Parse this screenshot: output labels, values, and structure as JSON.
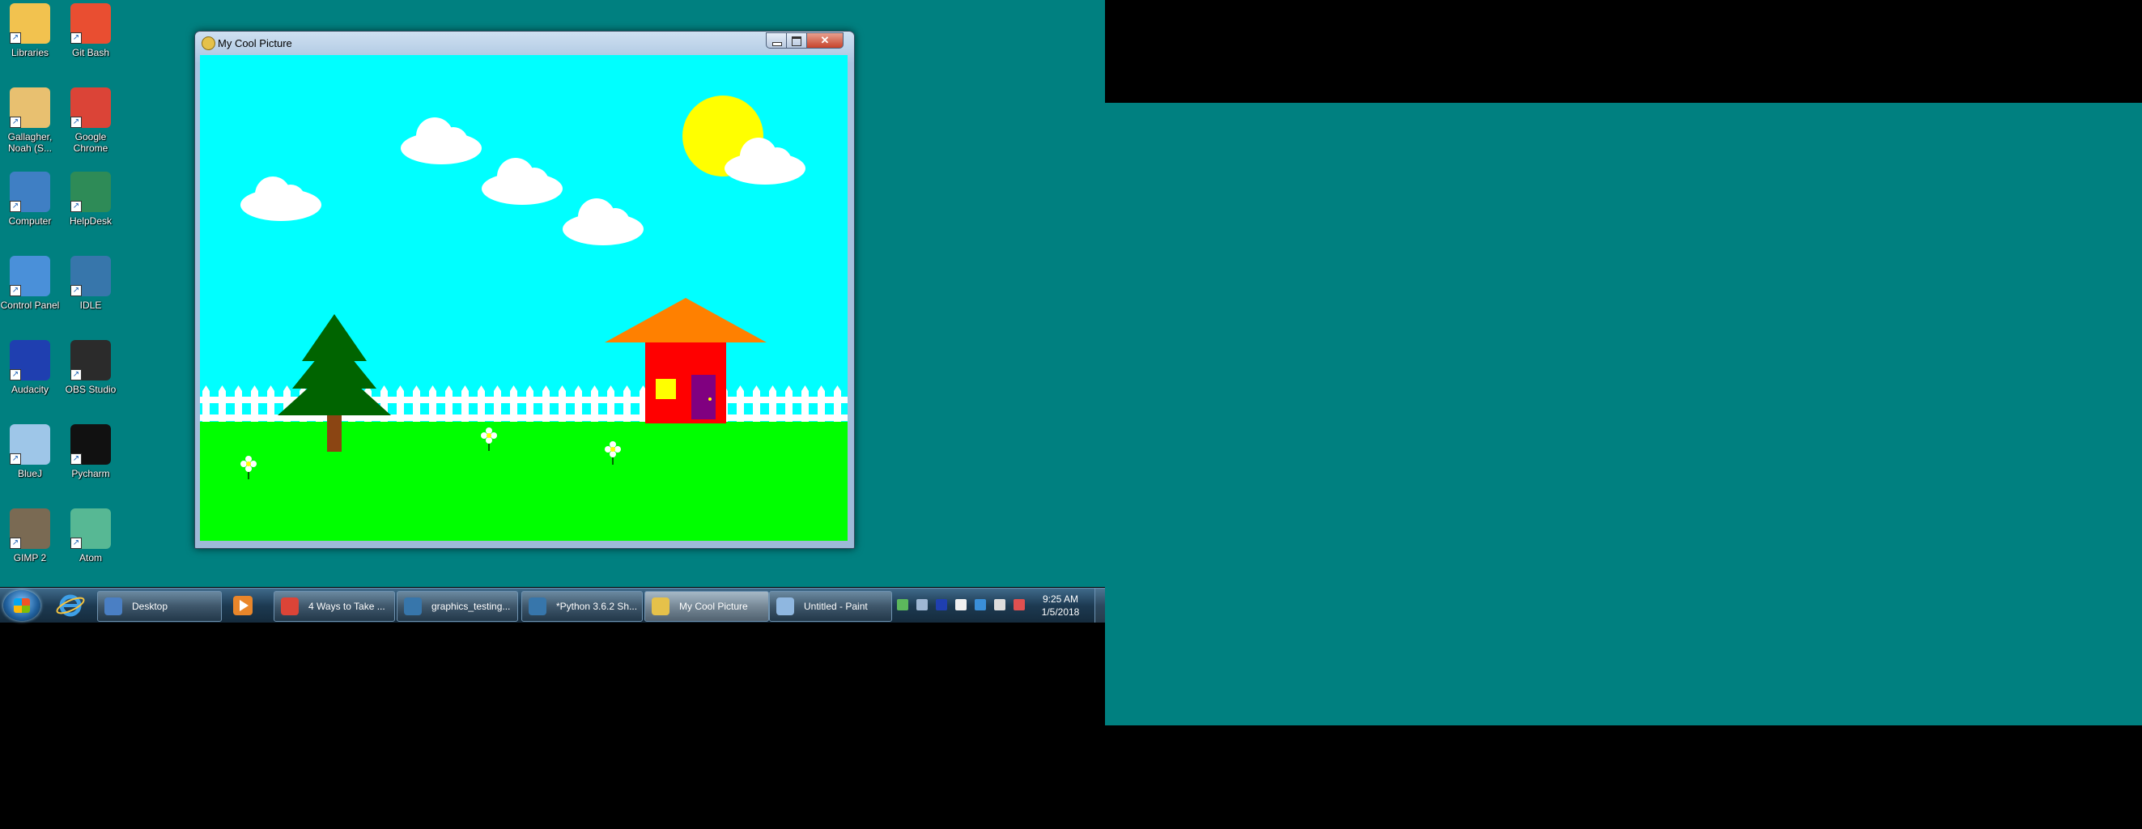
{
  "desktop_icons": [
    {
      "label": "Libraries",
      "icon": "folder-icon",
      "color": "#f2c24f"
    },
    {
      "label": "Git Bash",
      "icon": "git-bash-icon",
      "color": "#e94e31"
    },
    {
      "label": "Gallagher, Noah (S...",
      "icon": "user-folder-icon",
      "color": "#e8c070"
    },
    {
      "label": "Google Chrome",
      "icon": "chrome-icon",
      "color": "#db4437"
    },
    {
      "label": "Computer",
      "icon": "computer-icon",
      "color": "#3f7fc4"
    },
    {
      "label": "HelpDesk",
      "icon": "helpdesk-icon",
      "color": "#2e8b57"
    },
    {
      "label": "Control Panel",
      "icon": "control-panel-icon",
      "color": "#4a90d9"
    },
    {
      "label": "IDLE",
      "icon": "python-idle-icon",
      "color": "#3776ab"
    },
    {
      "label": "Audacity",
      "icon": "audacity-icon",
      "color": "#1f3fb0"
    },
    {
      "label": "OBS Studio",
      "icon": "obs-icon",
      "color": "#2b2b2b"
    },
    {
      "label": "BlueJ",
      "icon": "bluej-icon",
      "color": "#9ec6e8"
    },
    {
      "label": "Pycharm",
      "icon": "pycharm-icon",
      "color": "#111111"
    },
    {
      "label": "GIMP 2",
      "icon": "gimp-icon",
      "color": "#7a6a53"
    },
    {
      "label": "Atom",
      "icon": "atom-icon",
      "color": "#57b894"
    }
  ],
  "window": {
    "title": "My Cool Picture",
    "close_label": "✕"
  },
  "scene": {
    "sky": "#00ffff",
    "grass": "#00ff00",
    "sun": "#ffff00",
    "house_wall": "#ff0000",
    "roof": "#ff8000",
    "door": "#800080",
    "window": "#ffff00",
    "tree": "#006400",
    "trunk": "#8b4513",
    "fence": "#ffffff"
  },
  "taskbar": {
    "items": [
      {
        "label": "Desktop",
        "icon": "desktop-icon",
        "active": false
      },
      {
        "label": "4 Ways to Take ...",
        "icon": "chrome-icon",
        "active": false
      },
      {
        "label": "graphics_testing...",
        "icon": "python-file-icon",
        "active": false
      },
      {
        "label": "*Python 3.6.2 Sh...",
        "icon": "python-shell-icon",
        "active": false
      },
      {
        "label": "My Cool Picture",
        "icon": "pygame-icon",
        "active": true
      },
      {
        "label": "Untitled - Paint",
        "icon": "paint-icon",
        "active": false
      }
    ],
    "clock_time": "9:25 AM",
    "clock_date": "1/5/2018"
  }
}
